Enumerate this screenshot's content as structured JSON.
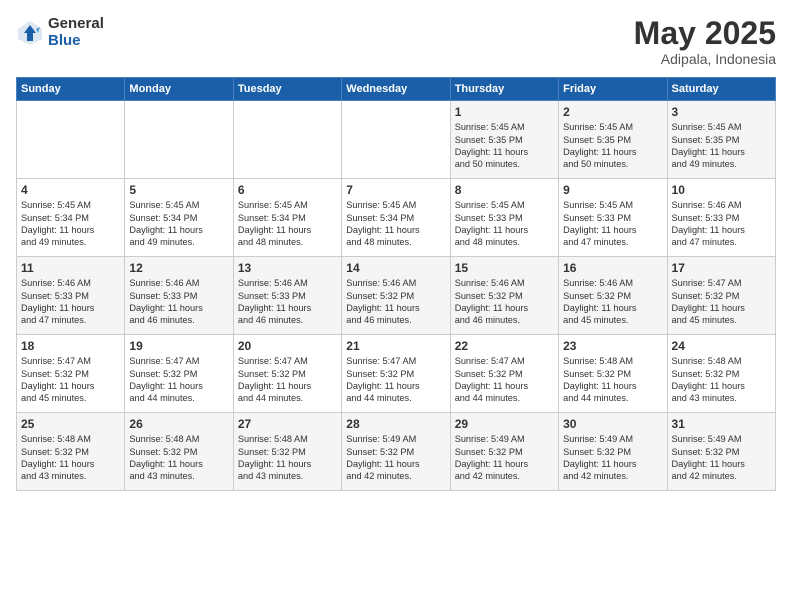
{
  "header": {
    "logo_general": "General",
    "logo_blue": "Blue",
    "title": "May 2025",
    "subtitle": "Adipala, Indonesia"
  },
  "days_header": [
    "Sunday",
    "Monday",
    "Tuesday",
    "Wednesday",
    "Thursday",
    "Friday",
    "Saturday"
  ],
  "weeks": [
    [
      {
        "day": "",
        "content": ""
      },
      {
        "day": "",
        "content": ""
      },
      {
        "day": "",
        "content": ""
      },
      {
        "day": "",
        "content": ""
      },
      {
        "day": "1",
        "content": "Sunrise: 5:45 AM\nSunset: 5:35 PM\nDaylight: 11 hours\nand 50 minutes."
      },
      {
        "day": "2",
        "content": "Sunrise: 5:45 AM\nSunset: 5:35 PM\nDaylight: 11 hours\nand 50 minutes."
      },
      {
        "day": "3",
        "content": "Sunrise: 5:45 AM\nSunset: 5:35 PM\nDaylight: 11 hours\nand 49 minutes."
      }
    ],
    [
      {
        "day": "4",
        "content": "Sunrise: 5:45 AM\nSunset: 5:34 PM\nDaylight: 11 hours\nand 49 minutes."
      },
      {
        "day": "5",
        "content": "Sunrise: 5:45 AM\nSunset: 5:34 PM\nDaylight: 11 hours\nand 49 minutes."
      },
      {
        "day": "6",
        "content": "Sunrise: 5:45 AM\nSunset: 5:34 PM\nDaylight: 11 hours\nand 48 minutes."
      },
      {
        "day": "7",
        "content": "Sunrise: 5:45 AM\nSunset: 5:34 PM\nDaylight: 11 hours\nand 48 minutes."
      },
      {
        "day": "8",
        "content": "Sunrise: 5:45 AM\nSunset: 5:33 PM\nDaylight: 11 hours\nand 48 minutes."
      },
      {
        "day": "9",
        "content": "Sunrise: 5:45 AM\nSunset: 5:33 PM\nDaylight: 11 hours\nand 47 minutes."
      },
      {
        "day": "10",
        "content": "Sunrise: 5:46 AM\nSunset: 5:33 PM\nDaylight: 11 hours\nand 47 minutes."
      }
    ],
    [
      {
        "day": "11",
        "content": "Sunrise: 5:46 AM\nSunset: 5:33 PM\nDaylight: 11 hours\nand 47 minutes."
      },
      {
        "day": "12",
        "content": "Sunrise: 5:46 AM\nSunset: 5:33 PM\nDaylight: 11 hours\nand 46 minutes."
      },
      {
        "day": "13",
        "content": "Sunrise: 5:46 AM\nSunset: 5:33 PM\nDaylight: 11 hours\nand 46 minutes."
      },
      {
        "day": "14",
        "content": "Sunrise: 5:46 AM\nSunset: 5:32 PM\nDaylight: 11 hours\nand 46 minutes."
      },
      {
        "day": "15",
        "content": "Sunrise: 5:46 AM\nSunset: 5:32 PM\nDaylight: 11 hours\nand 46 minutes."
      },
      {
        "day": "16",
        "content": "Sunrise: 5:46 AM\nSunset: 5:32 PM\nDaylight: 11 hours\nand 45 minutes."
      },
      {
        "day": "17",
        "content": "Sunrise: 5:47 AM\nSunset: 5:32 PM\nDaylight: 11 hours\nand 45 minutes."
      }
    ],
    [
      {
        "day": "18",
        "content": "Sunrise: 5:47 AM\nSunset: 5:32 PM\nDaylight: 11 hours\nand 45 minutes."
      },
      {
        "day": "19",
        "content": "Sunrise: 5:47 AM\nSunset: 5:32 PM\nDaylight: 11 hours\nand 44 minutes."
      },
      {
        "day": "20",
        "content": "Sunrise: 5:47 AM\nSunset: 5:32 PM\nDaylight: 11 hours\nand 44 minutes."
      },
      {
        "day": "21",
        "content": "Sunrise: 5:47 AM\nSunset: 5:32 PM\nDaylight: 11 hours\nand 44 minutes."
      },
      {
        "day": "22",
        "content": "Sunrise: 5:47 AM\nSunset: 5:32 PM\nDaylight: 11 hours\nand 44 minutes."
      },
      {
        "day": "23",
        "content": "Sunrise: 5:48 AM\nSunset: 5:32 PM\nDaylight: 11 hours\nand 44 minutes."
      },
      {
        "day": "24",
        "content": "Sunrise: 5:48 AM\nSunset: 5:32 PM\nDaylight: 11 hours\nand 43 minutes."
      }
    ],
    [
      {
        "day": "25",
        "content": "Sunrise: 5:48 AM\nSunset: 5:32 PM\nDaylight: 11 hours\nand 43 minutes."
      },
      {
        "day": "26",
        "content": "Sunrise: 5:48 AM\nSunset: 5:32 PM\nDaylight: 11 hours\nand 43 minutes."
      },
      {
        "day": "27",
        "content": "Sunrise: 5:48 AM\nSunset: 5:32 PM\nDaylight: 11 hours\nand 43 minutes."
      },
      {
        "day": "28",
        "content": "Sunrise: 5:49 AM\nSunset: 5:32 PM\nDaylight: 11 hours\nand 42 minutes."
      },
      {
        "day": "29",
        "content": "Sunrise: 5:49 AM\nSunset: 5:32 PM\nDaylight: 11 hours\nand 42 minutes."
      },
      {
        "day": "30",
        "content": "Sunrise: 5:49 AM\nSunset: 5:32 PM\nDaylight: 11 hours\nand 42 minutes."
      },
      {
        "day": "31",
        "content": "Sunrise: 5:49 AM\nSunset: 5:32 PM\nDaylight: 11 hours\nand 42 minutes."
      }
    ]
  ]
}
